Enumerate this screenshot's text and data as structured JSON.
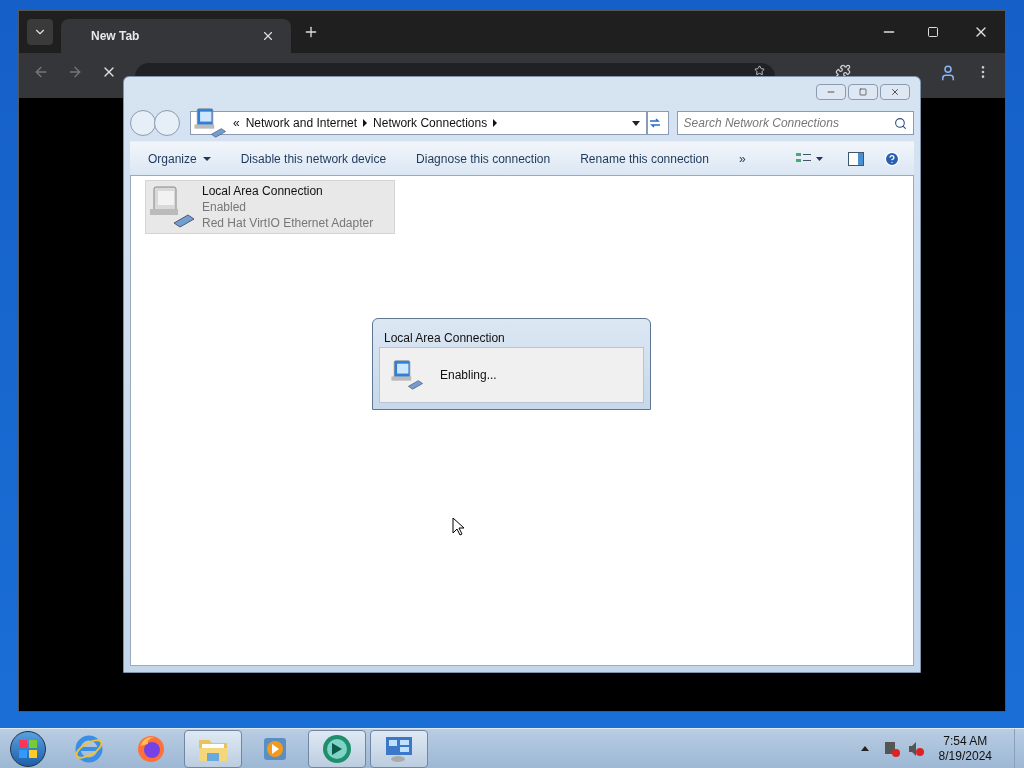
{
  "browser": {
    "tab_title": "New Tab"
  },
  "explorer": {
    "breadcrumb_prefix": "«",
    "breadcrumb": [
      "Network and Internet",
      "Network Connections"
    ],
    "search": {
      "placeholder": "Search Network Connections"
    },
    "commands": [
      {
        "label": "Organize",
        "kind": "menu"
      },
      {
        "label": "Disable this network device",
        "kind": "plain"
      },
      {
        "label": "Diagnose this connection",
        "kind": "plain"
      },
      {
        "label": "Rename this connection",
        "kind": "plain"
      },
      {
        "label": "»",
        "kind": "plain"
      }
    ],
    "items": [
      {
        "name": "Local Area Connection",
        "status": "Enabled",
        "adapter": "Red Hat VirtIO Ethernet Adapter",
        "selected": true
      }
    ]
  },
  "dialog": {
    "title": "Local Area Connection",
    "message": "Enabling..."
  },
  "taskbar": {
    "apps": [
      {
        "kind": "ie",
        "open": false
      },
      {
        "kind": "firefox",
        "open": false
      },
      {
        "kind": "folder",
        "open": true
      },
      {
        "kind": "media",
        "open": false
      },
      {
        "kind": "globe",
        "open": true
      },
      {
        "kind": "network",
        "open": true
      }
    ],
    "time": "7:54 AM",
    "date": "8/19/2024"
  }
}
